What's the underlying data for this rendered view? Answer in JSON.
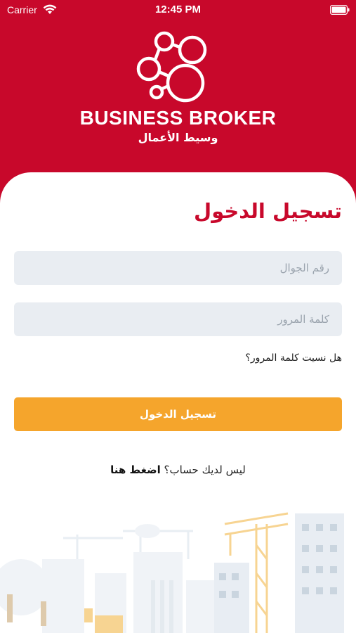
{
  "status_bar": {
    "carrier": "Carrier",
    "time": "12:45 PM"
  },
  "brand": {
    "name_en": "BUSINESS BROKER",
    "name_ar": "وسيط الأعمال"
  },
  "login": {
    "title": "تسجيل الدخول",
    "phone_placeholder": "رقم الجوال",
    "password_placeholder": "كلمة المرور",
    "forgot_password": "هل نسيت كلمة المرور؟",
    "submit_label": "تسجيل الدخول",
    "no_account_text": "ليس لديك حساب؟",
    "signup_link": "اضغط هنا"
  },
  "colors": {
    "brand_red": "#c8082b",
    "button_orange": "#f5a52c",
    "input_bg": "#e9edf2"
  },
  "icons": [
    "wifi-icon",
    "battery-icon",
    "logo-circles-icon"
  ]
}
